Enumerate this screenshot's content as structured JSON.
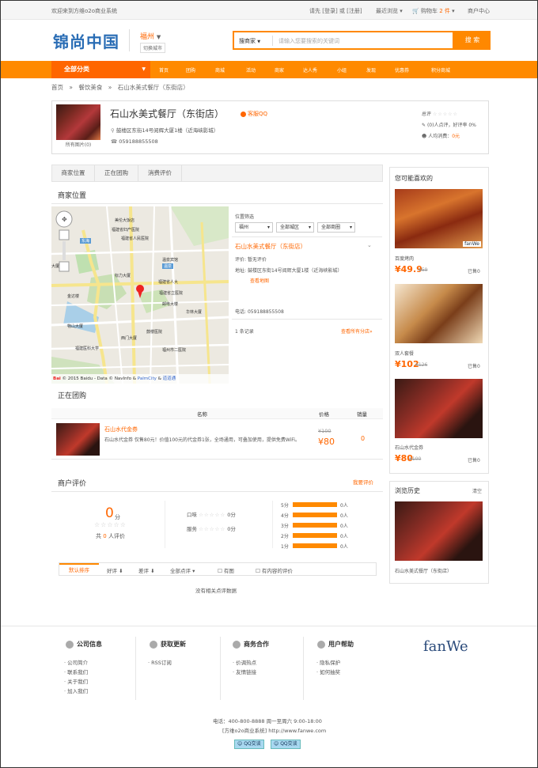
{
  "topbar": {
    "welcome": "欢迎来到方维o2o商业系统",
    "login_prompt": "请先 [登录] 或 [注册]",
    "recent": "最近浏览",
    "cart": "购物车",
    "cart_count": "2 件",
    "user_center": "商户中心"
  },
  "header": {
    "logo": "锦尚中国",
    "city": "福州",
    "switch_city": "切换城市",
    "search_type": "搜商家",
    "search_placeholder": "请输入您要搜索的关键词",
    "search_button": "搜 索"
  },
  "nav": {
    "all": "全部分类",
    "items": [
      "首页",
      "团购",
      "商城",
      "活动",
      "商家",
      "达人秀",
      "小组",
      "发现",
      "优惠券",
      "积分商城"
    ]
  },
  "breadcrumb": {
    "home": "首页",
    "cat": "餐饮美食",
    "shop": "石山水美式餐厅（东街店）",
    "sep": "»"
  },
  "shop": {
    "name": "石山水美式餐厅（东街店）",
    "photos": "所有图片(0)",
    "service": "客服QQ",
    "address": "鼓楼区东街14号阅辉大厦1楼（近海峡影城）",
    "phone": "059188855508",
    "overall": "总评",
    "reviews_line": "(0)人点评，好评率 0%",
    "avg_cost_label": "人均消费：",
    "avg_cost": "0元"
  },
  "tabs": [
    "商家位置",
    "正在团购",
    "消费评价"
  ],
  "location": {
    "title": "商家位置",
    "filter_title": "位置筛选",
    "filters": [
      "福州",
      "全部城区",
      "全部商圈"
    ],
    "branch_name": "石山水美式餐厅（东街店）",
    "rating": "评价: 暂无评价",
    "addr_label": "地址:",
    "addr": "鼓楼区东街14号阅辉大厦1楼（近海峡影城）",
    "view_map": "查看地图",
    "phone_label": "电话:",
    "phone": "059188855508",
    "count": "1 条记录",
    "all_branches": "查看所有分店»",
    "copyright": "© 2015 Baidu - Data ©",
    "navinfo": "NavInfo",
    "pc": "PalmCity",
    "dao": "道道通"
  },
  "map_labels": [
    "美伦大饭店",
    "福建省妇产医院",
    "福建省人民医院",
    "东海",
    "大厦",
    "温泉宾馆",
    "标力大厦",
    "冶山",
    "福建省老年医院",
    "福建省立医院",
    "福建省人大",
    "华林大厦",
    "邮电大楼",
    "福建大学",
    "温泉",
    "鼓楼医院",
    "福建医科大学",
    "东街口",
    "沙溪",
    "福州市二医院",
    "福建科技大厦",
    "华侨大厦",
    "西湖",
    "左海",
    "省体育中心",
    "金达楼",
    "五四北",
    "凤河",
    "六一中路",
    "物山大厦",
    "西门大厦",
    "象峰",
    "福建省二院",
    "杨桥中路",
    "杨桥",
    "杨桥东路",
    "福州大学"
  ],
  "deals": {
    "title": "正在团购",
    "head_name": "名称",
    "head_price": "价格",
    "head_sales": "销量",
    "item": {
      "name": "石山水代金券",
      "desc": "石山水代金券 仅售80元！价值100元的代金券1张，全场通用，可叠加使用，提供免费WiFi。",
      "orig": "¥100",
      "price": "¥80",
      "sales": "0"
    }
  },
  "reviews": {
    "title": "商户评价",
    "write": "我要评价",
    "score": "0",
    "score_unit": "分",
    "count_prefix": "共",
    "count": "0",
    "count_suffix": "人评价",
    "dims": [
      {
        "label": "口味",
        "score": "0分"
      },
      {
        "label": "服务",
        "score": "0分"
      }
    ],
    "dist": [
      {
        "label": "5分",
        "count": "0人",
        "frac": 1
      },
      {
        "label": "4分",
        "count": "0人",
        "frac": 1
      },
      {
        "label": "3分",
        "count": "0人",
        "frac": 1
      },
      {
        "label": "2分",
        "count": "0人",
        "frac": 1
      },
      {
        "label": "1分",
        "count": "0人",
        "frac": 1
      }
    ],
    "sorts": [
      "默认排序",
      "好评",
      "差评",
      "全部点评",
      "有图",
      "有内容的评价"
    ],
    "empty": "没有相关点评数据"
  },
  "sidebar": {
    "like_title": "您可能喜欢的",
    "items": [
      {
        "name": "百度烤肉",
        "price": "¥49.9",
        "orig": "¥59",
        "sold": "已售0",
        "wm": "fanWe"
      },
      {
        "name": "双人套餐",
        "price": "¥102",
        "orig": "¥126",
        "sold": "已售0"
      },
      {
        "name": "石山水代金券",
        "price": "¥80",
        "orig": "¥100",
        "sold": "已售0"
      }
    ],
    "history_title": "浏览历史",
    "clear": "清空",
    "history": [
      {
        "name": "石山水美式餐厅（东街店）"
      }
    ]
  },
  "footer": {
    "cols": [
      {
        "title": "公司信息",
        "links": [
          "公司简介",
          "联系我们",
          "关于我们",
          "加入我们"
        ]
      },
      {
        "title": "获取更新",
        "links": [
          "RSS订阅"
        ]
      },
      {
        "title": "商务合作",
        "links": [
          "价调热点",
          "友情链接"
        ]
      },
      {
        "title": "用户帮助",
        "links": [
          "隐私保护",
          "如何抽奖"
        ]
      }
    ],
    "brand": "fanWe",
    "tel": "电话：400-800-8888 周一至周六 9:00-18:00",
    "copy": "[方维o2o商业系统] http://www.fanwe.com",
    "qq": [
      "QQ交谈",
      "QQ交谈"
    ]
  },
  "colors": {
    "orange": "#ff8a00",
    "deep_orange": "#ff6600",
    "blue": "#2a6db5"
  }
}
